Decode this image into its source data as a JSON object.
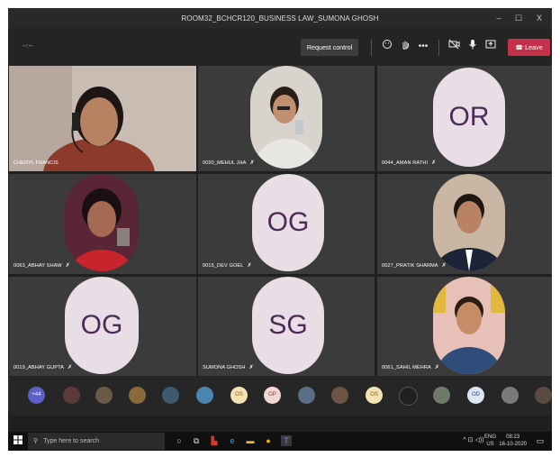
{
  "window": {
    "title": "ROOM32_BCHCR120_BUSINESS LAW_SUMONA GHOSH",
    "minimize": "–",
    "maximize": "☐",
    "close": "X"
  },
  "toolbar": {
    "timer": "--:--",
    "request_control": "Request control",
    "leave": "Leave"
  },
  "participants": [
    {
      "name": "CHERYL FRANCIS"
    },
    {
      "name": "0020_MEHUL JHA"
    },
    {
      "name": "0044_AMAN RATHI",
      "initials": "OR"
    },
    {
      "name": "0063_ABHAY SHAW"
    },
    {
      "name": "0015_DEV GOEL",
      "initials": "OG"
    },
    {
      "name": "0027_PRATIK SHARMA"
    },
    {
      "name": "0019_ABHAY GUPTA",
      "initials": "OG"
    },
    {
      "name": "SUMONA GHOSH",
      "initials": "SG"
    },
    {
      "name": "0061_SAHIL MEHRA"
    }
  ],
  "roster": {
    "overflow": "+44",
    "initials": [
      "OS",
      "OP",
      "OS",
      "OD"
    ]
  },
  "taskbar": {
    "search_placeholder": "Type here to search",
    "lang_line1": "ENG",
    "lang_line2": "US",
    "time": "08:23",
    "date": "16-10-2020"
  },
  "colors": {
    "leave": "#c4314b",
    "initial_bg": "#e9dde6",
    "initial_fg": "#4b2b58",
    "tile": "#3b3b3b"
  }
}
